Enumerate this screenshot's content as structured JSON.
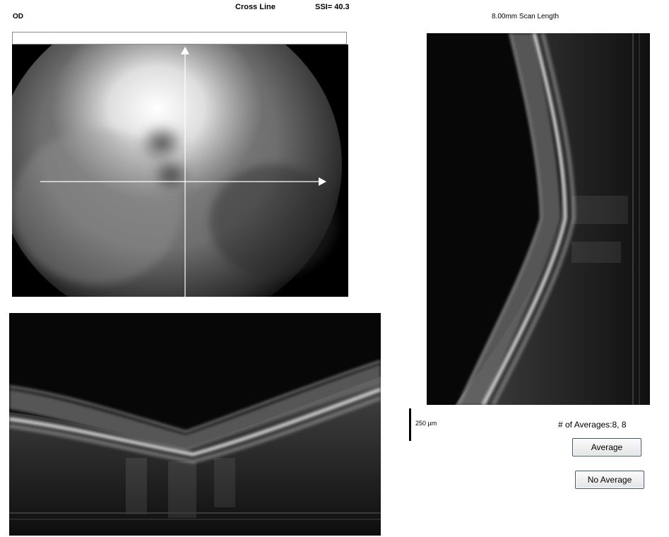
{
  "header": {
    "eye": "OD",
    "scan_type": "Cross Line",
    "ssi": "SSI= 40.3",
    "scan_length": "8.00mm Scan Length"
  },
  "scale": {
    "label": "250 µm"
  },
  "averaging": {
    "label": "# of Averages:8, 8",
    "average_button": "Average",
    "no_average_button": "No Average"
  },
  "icons": [
    "crosshair-arrow-up-icon",
    "crosshair-arrow-right-icon"
  ]
}
